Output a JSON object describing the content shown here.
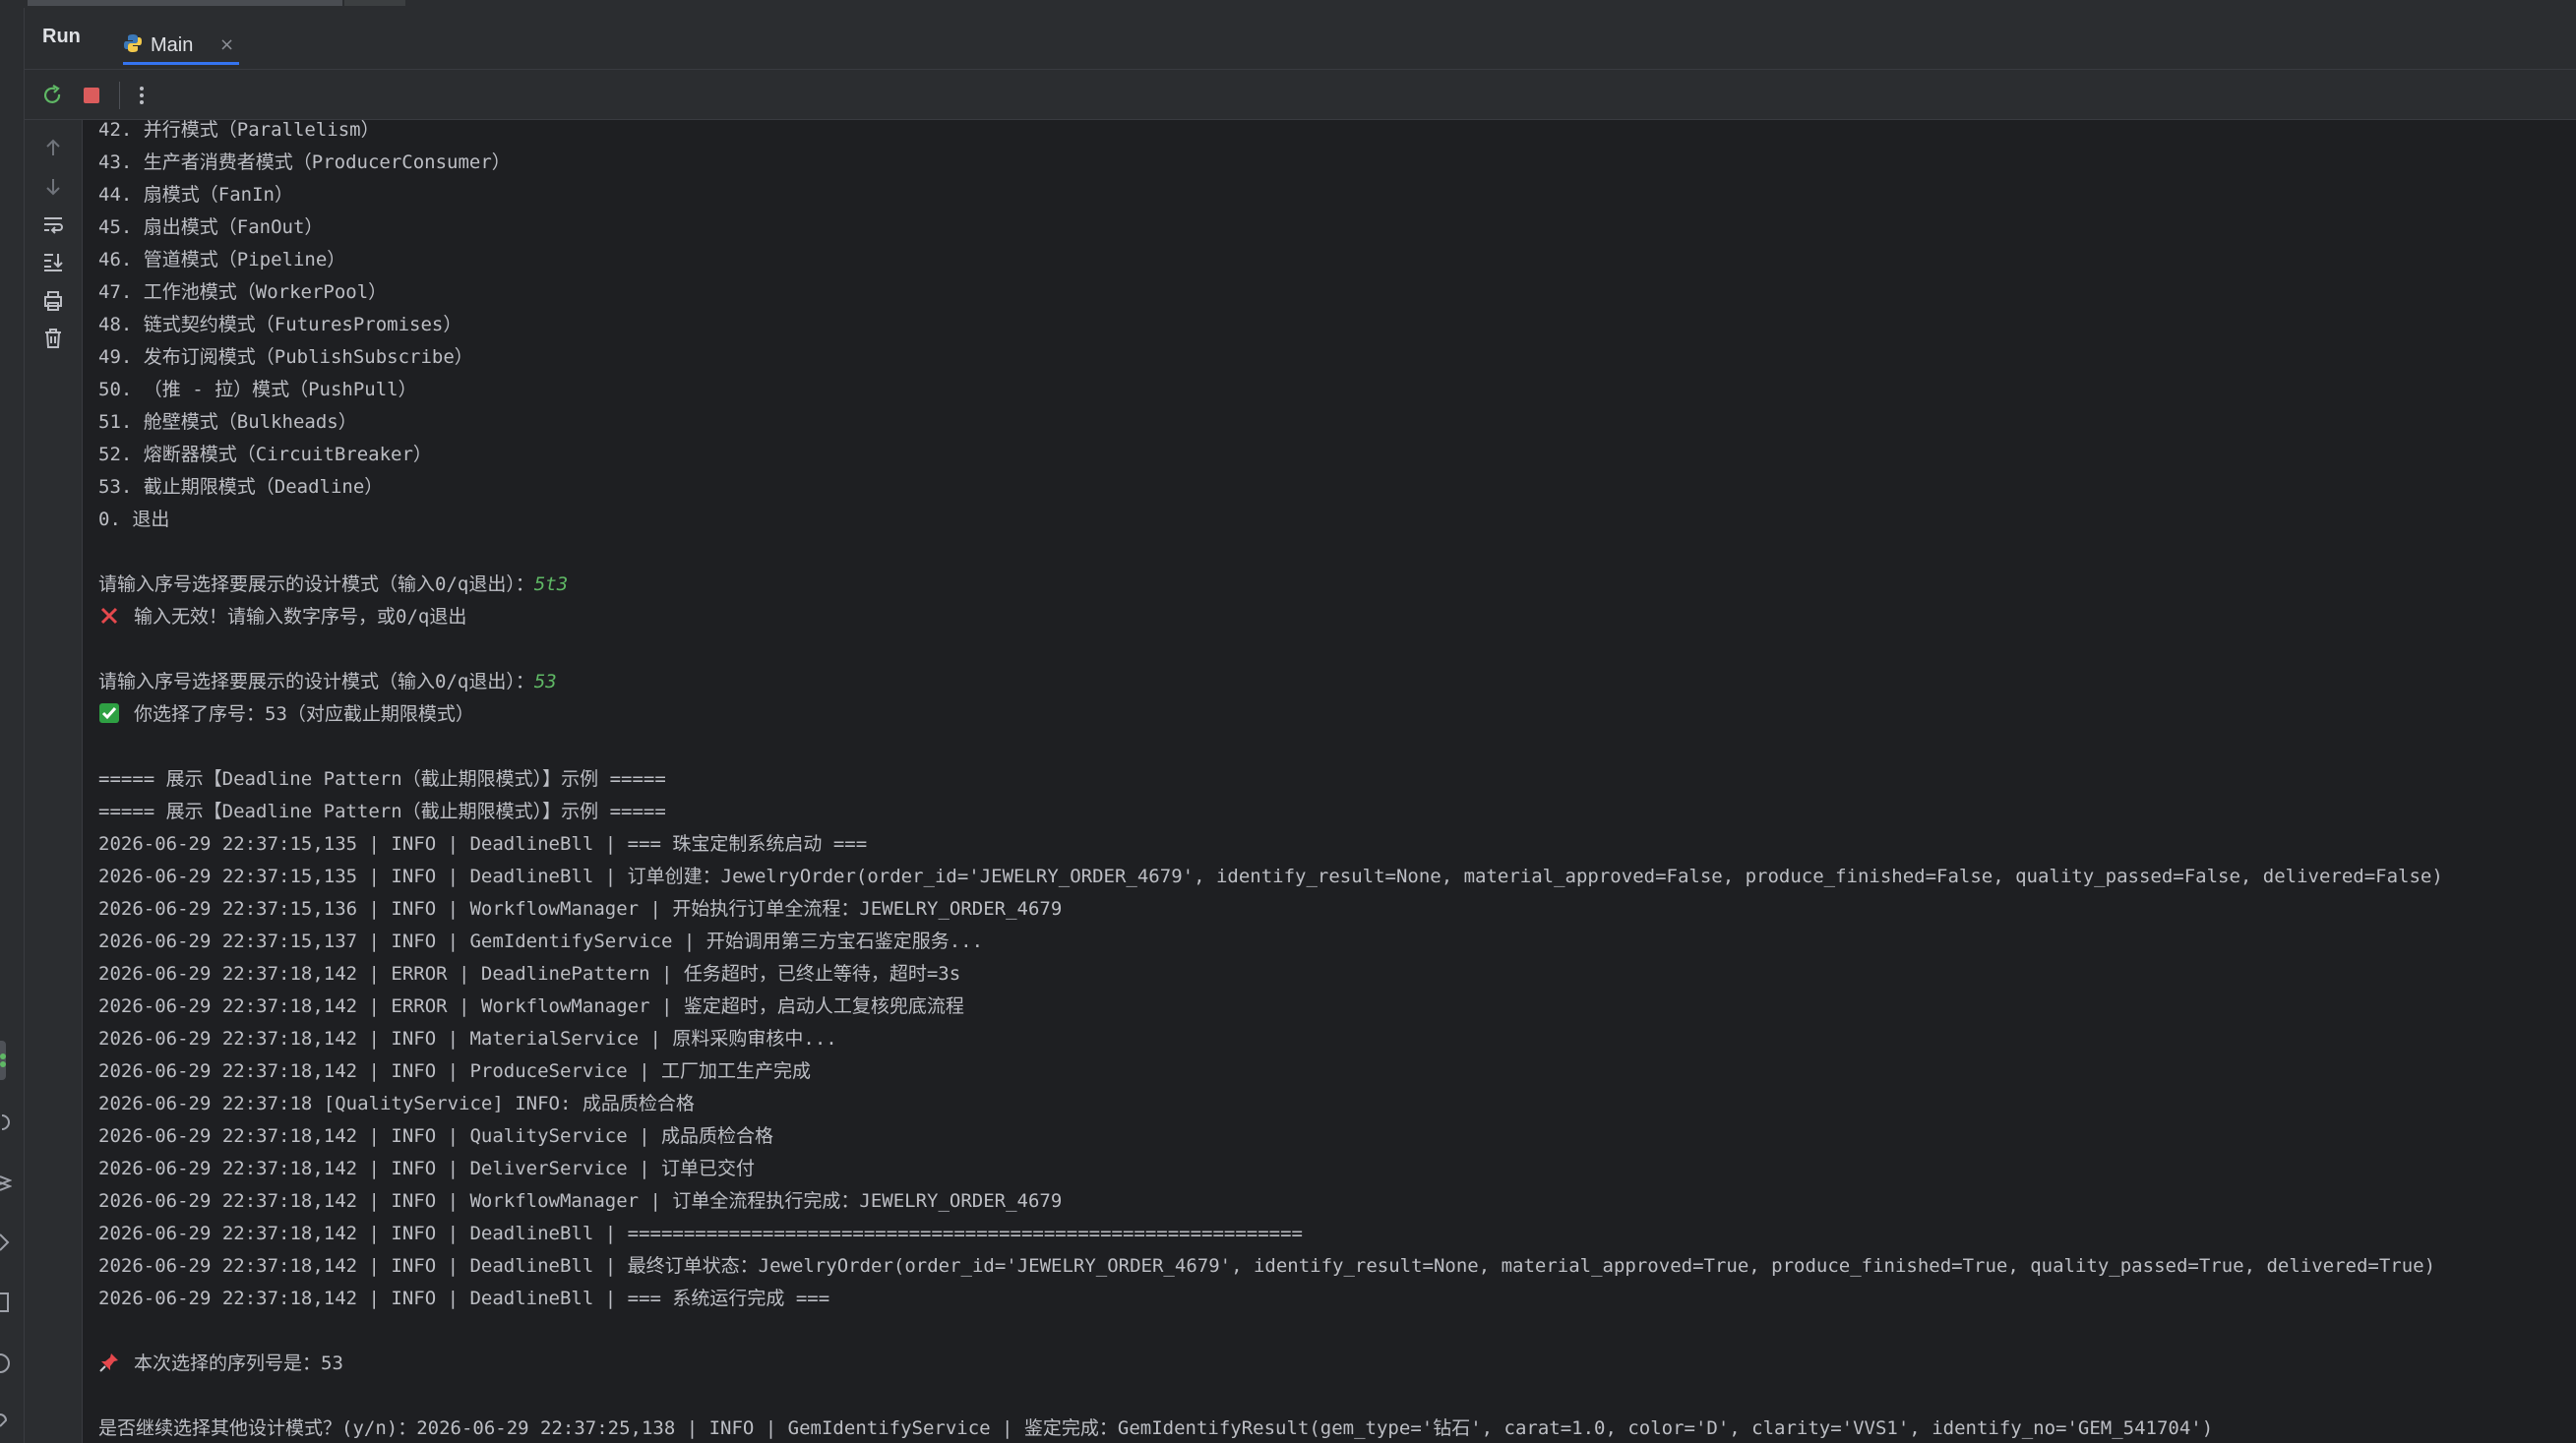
{
  "tabs": {
    "run_label": "Run",
    "main_label": "Main",
    "close_glyph": "×"
  },
  "icons": {
    "rerun": "rerun-icon",
    "stop": "stop-icon",
    "more": "more-vertical-icon",
    "up": "arrow-up-icon",
    "down": "arrow-down-icon",
    "wrap": "soft-wrap-icon",
    "scroll_end": "scroll-to-end-icon",
    "print": "print-icon",
    "trash": "trash-icon",
    "python": "python-icon",
    "error": "cross-mark-icon",
    "success": "check-mark-icon",
    "pin": "pushpin-icon"
  },
  "colors": {
    "background": "#1e1f22",
    "text": "#bcbec4",
    "user_input": "#5fb865",
    "error_mark": "#e5484d",
    "success_mark": "#2ea043",
    "accent": "#3574f0",
    "stop": "#db5c5c"
  },
  "console": {
    "menu": [
      "42. 并行模式（Parallelism）",
      "43. 生产者消费者模式（ProducerConsumer）",
      "44. 扇模式（FanIn）",
      "45. 扇出模式（FanOut）",
      "46. 管道模式（Pipeline）",
      "47. 工作池模式（WorkerPool）",
      "48. 链式契约模式（FuturesPromises）",
      "49. 发布订阅模式（PublishSubscribe）",
      "50. （推 - 拉）模式（PushPull）",
      "51. 舱壁模式（Bulkheads）",
      "52. 熔断器模式（CircuitBreaker）",
      "53. 截止期限模式（Deadline）",
      "0. 退出"
    ],
    "prompt1": "请输入序号选择要展示的设计模式（输入0/q退出）：",
    "input1": "5t3",
    "error_msg": "输入无效！请输入数字序号，或0/q退出",
    "prompt2": "请输入序号选择要展示的设计模式（输入0/q退出）：",
    "input2": "53",
    "selected_msg": "你选择了序号：53（对应截止期限模式）",
    "banner": "===== 展示【Deadline Pattern（截止期限模式）】示例 =====",
    "logs": [
      "2026-06-29 22:37:15,135 | INFO | DeadlineBll | === 珠宝定制系统启动 ===",
      "2026-06-29 22:37:15,135 | INFO | DeadlineBll | 订单创建：JewelryOrder(order_id='JEWELRY_ORDER_4679', identify_result=None, material_approved=False, produce_finished=False, quality_passed=False, delivered=False)",
      "2026-06-29 22:37:15,136 | INFO | WorkflowManager | 开始执行订单全流程：JEWELRY_ORDER_4679",
      "2026-06-29 22:37:15,137 | INFO | GemIdentifyService | 开始调用第三方宝石鉴定服务...",
      "2026-06-29 22:37:18,142 | ERROR | DeadlinePattern | 任务超时，已终止等待，超时=3s",
      "2026-06-29 22:37:18,142 | ERROR | WorkflowManager | 鉴定超时，启动人工复核兜底流程",
      "2026-06-29 22:37:18,142 | INFO | MaterialService | 原料采购审核中...",
      "2026-06-29 22:37:18,142 | INFO | ProduceService | 工厂加工生产完成",
      "2026-06-29 22:37:18 [QualityService] INFO: 成品质检合格",
      "2026-06-29 22:37:18,142 | INFO | QualityService | 成品质检合格",
      "2026-06-29 22:37:18,142 | INFO | DeliverService | 订单已交付",
      "2026-06-29 22:37:18,142 | INFO | WorkflowManager | 订单全流程执行完成：JEWELRY_ORDER_4679",
      "2026-06-29 22:37:18,142 | INFO | DeadlineBll | ============================================================",
      "2026-06-29 22:37:18,142 | INFO | DeadlineBll | 最终订单状态：JewelryOrder(order_id='JEWELRY_ORDER_4679', identify_result=None, material_approved=True, produce_finished=True, quality_passed=True, delivered=True)",
      "2026-06-29 22:37:18,142 | INFO | DeadlineBll | === 系统运行完成 ==="
    ],
    "pin_msg": "本次选择的序列号是：53",
    "last_line": "是否继续选择其他设计模式？(y/n)：2026-06-29 22:37:25,138 | INFO | GemIdentifyService | 鉴定完成：GemIdentifyResult(gem_type='钻石', carat=1.0, color='D', clarity='VVS1', identify_no='GEM_541704')"
  }
}
